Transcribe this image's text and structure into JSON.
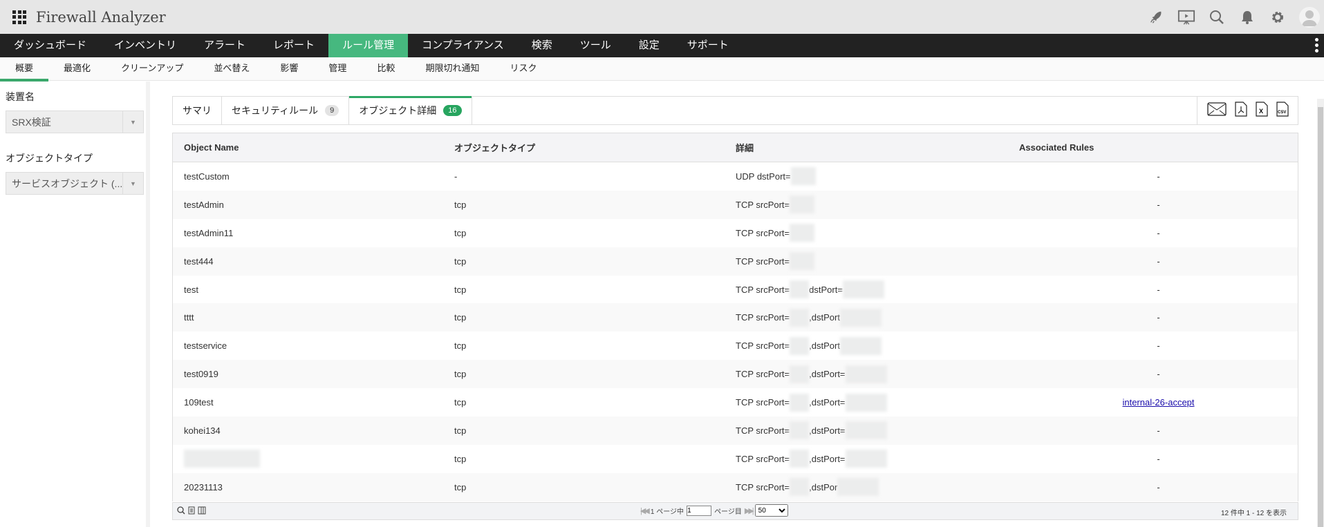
{
  "header": {
    "title": "Firewall Analyzer",
    "icons": [
      "rocket-icon",
      "presentation-icon",
      "search-icon",
      "bell-icon",
      "gear-icon",
      "avatar-icon"
    ]
  },
  "nav": {
    "items": [
      "ダッシュボード",
      "インベントリ",
      "アラート",
      "レポート",
      "ルール管理",
      "コンプライアンス",
      "検索",
      "ツール",
      "設定",
      "サポート"
    ],
    "active": "ルール管理"
  },
  "subnav": {
    "items": [
      "概要",
      "最適化",
      "クリーンアップ",
      "並べ替え",
      "影響",
      "管理",
      "比較",
      "期限切れ通知",
      "リスク"
    ],
    "active": "概要"
  },
  "sidebar": {
    "device_label": "装置名",
    "device_value": "SRX検証",
    "type_label": "オブジェクトタイプ",
    "type_value": "サービスオブジェクト (..."
  },
  "tabs": [
    {
      "label": "サマリ"
    },
    {
      "label": "セキュリティルール",
      "badge": "9"
    },
    {
      "label": "オブジェクト詳細",
      "badge": "16"
    }
  ],
  "exports": [
    "email-icon",
    "pdf-icon",
    "excel-icon",
    "csv-icon"
  ],
  "table": {
    "headers": [
      "Object Name",
      "オブジェクトタイプ",
      "詳細",
      "Associated Rules"
    ],
    "rows": [
      {
        "name": "testCustom",
        "type": "-",
        "detail": [
          "UDP dstPort="
        ],
        "rules": "-"
      },
      {
        "name": "testAdmin",
        "type": "tcp",
        "detail": [
          "TCP srcPort="
        ],
        "rules": "-"
      },
      {
        "name": "testAdmin11",
        "type": "tcp",
        "detail": [
          "TCP srcPort="
        ],
        "rules": "-"
      },
      {
        "name": "test444",
        "type": "tcp",
        "detail": [
          "TCP srcPort="
        ],
        "rules": "-"
      },
      {
        "name": "test",
        "type": "tcp",
        "detail": [
          "TCP srcPort=",
          "dstPort="
        ],
        "rules": "-"
      },
      {
        "name": "tttt",
        "type": "tcp",
        "detail": [
          "TCP srcPort=",
          ",dstPort"
        ],
        "rules": "-"
      },
      {
        "name": "testservice",
        "type": "tcp",
        "detail": [
          "TCP srcPort=",
          ",dstPort"
        ],
        "rules": "-"
      },
      {
        "name": "test0919",
        "type": "tcp",
        "detail": [
          "TCP srcPort=",
          ",dstPort="
        ],
        "rules": "-"
      },
      {
        "name": "109test",
        "type": "tcp",
        "detail": [
          "TCP srcPort=",
          ",dstPort="
        ],
        "rules": "internal-26-accept"
      },
      {
        "name": "kohei134",
        "type": "tcp",
        "detail": [
          "TCP srcPort=",
          ",dstPort="
        ],
        "rules": "-"
      },
      {
        "name": "",
        "type": "tcp",
        "detail": [
          "TCP srcPort=",
          ",dstPort="
        ],
        "rules": "-"
      },
      {
        "name": "20231113",
        "type": "tcp",
        "detail": [
          "TCP srcPort=",
          ",dstPor"
        ],
        "rules": "-"
      }
    ]
  },
  "footer": {
    "page_prefix": "1 ページ中",
    "page_value": "1",
    "page_suffix": "ページ目",
    "page_size": "50",
    "count": "12 件中 1 - 12 を表示"
  }
}
